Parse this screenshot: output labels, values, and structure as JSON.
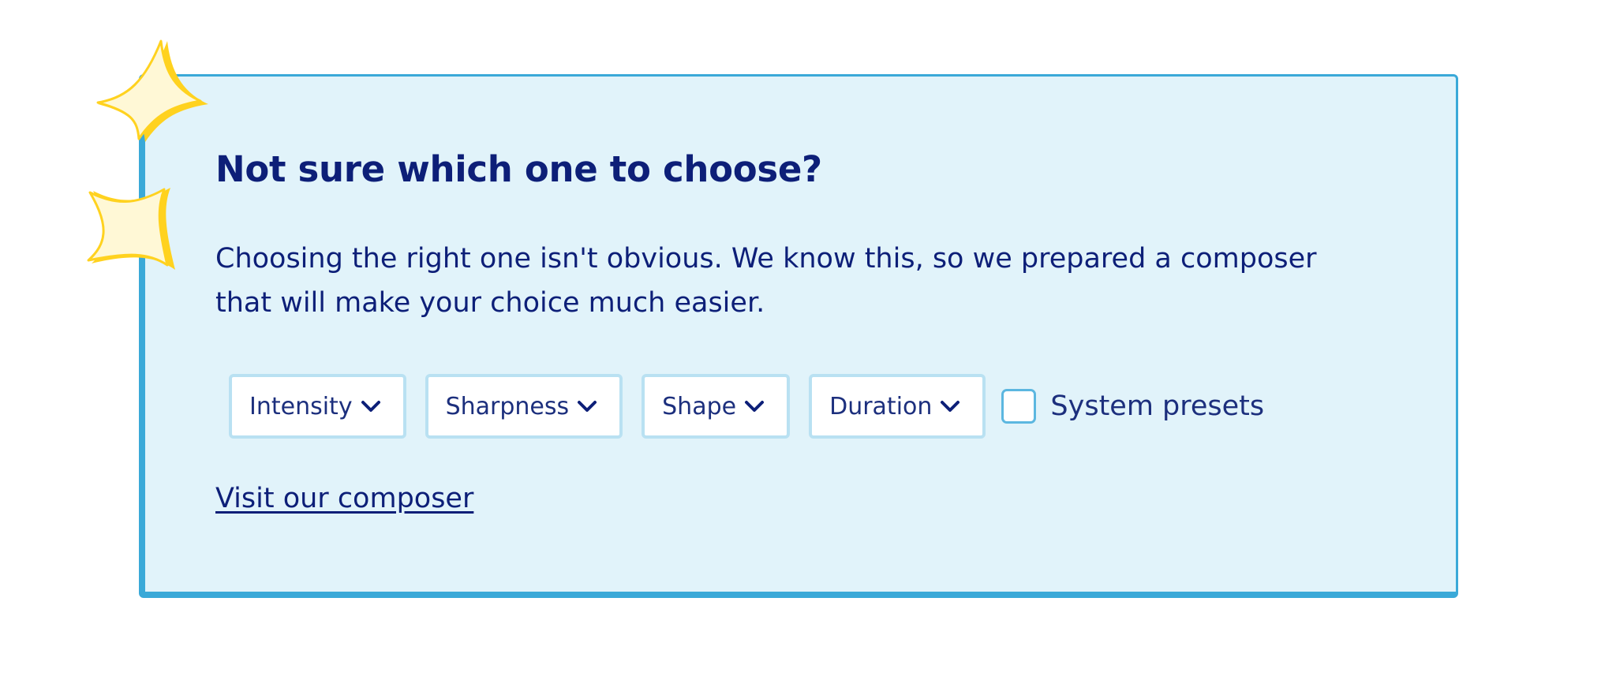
{
  "card": {
    "title": "Not sure which one to choose?",
    "description": "Choosing the right one isn't obvious. We know this, so we prepared a composer that will make your choice much easier.",
    "filters": [
      {
        "label": "Intensity"
      },
      {
        "label": "Sharpness"
      },
      {
        "label": "Shape"
      },
      {
        "label": "Duration"
      }
    ],
    "checkbox": {
      "label": "System presets",
      "checked": false
    },
    "link_text": "Visit our composer"
  },
  "decorations": {
    "stars": [
      "star-icon",
      "star-icon"
    ]
  },
  "colors": {
    "accent": "#3aa9d8",
    "card_background": "#e1f3fa",
    "text": "#0d1f78",
    "star_fill": "#fff8d6",
    "star_shadow": "#ffd21f"
  }
}
